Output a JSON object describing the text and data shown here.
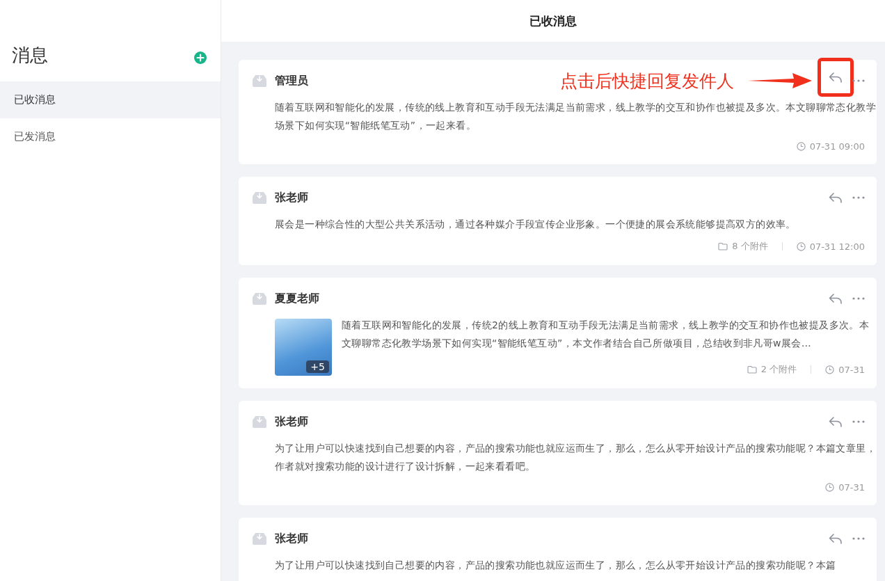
{
  "sidebar": {
    "title": "消息",
    "items": [
      {
        "label": "已收消息",
        "selected": true
      },
      {
        "label": "已发消息",
        "selected": false
      }
    ]
  },
  "header": {
    "title": "已收消息"
  },
  "annotation": {
    "text": "点击后快捷回复发件人"
  },
  "messages": [
    {
      "sender": "管理员",
      "body": "随着互联网和智能化的发展，传统的线上教育和互动手段无法满足当前需求，线上教学的交互和协作也被提及多次。本文聊聊常态化教学场景下如何实现“智能纸笔互动”，一起来看。",
      "time": "07-31 09:00",
      "highlighted": true
    },
    {
      "sender": "张老师",
      "body": "展会是一种综合性的大型公共关系活动，通过各种媒介手段宣传企业形象。一个便捷的展会系统能够提高双方的效率。",
      "attachments": "8 个附件",
      "time": "07-31 12:00",
      "highlighted": false
    },
    {
      "sender": "夏夏老师",
      "image_more": "+5",
      "body": "随着互联网和智能化的发展，传统2的线上教育和互动手段无法满足当前需求，线上教学的交互和协作也被提及多次。本文聊聊常态化教学场景下如何实现“智能纸笔互动”，本文作者结合自己所做项目，总结收到非凡哥w展会…",
      "attachments": "2 个附件",
      "time": "07-31",
      "highlighted": false
    },
    {
      "sender": "张老师",
      "body": "为了让用户可以快速找到自己想要的内容，产品的搜索功能也就应运而生了，那么，怎么从零开始设计产品的搜索功能呢？本篇文章里，作者就对搜索功能的设计进行了设计拆解，一起来看看吧。",
      "time": "07-31",
      "highlighted": false
    },
    {
      "sender": "张老师",
      "body": "为了让用户可以快速找到自己想要的内容，产品的搜索功能也就应运而生了，那么，怎么从零开始设计产品的搜索功能呢？本篇",
      "highlighted": false
    }
  ]
}
